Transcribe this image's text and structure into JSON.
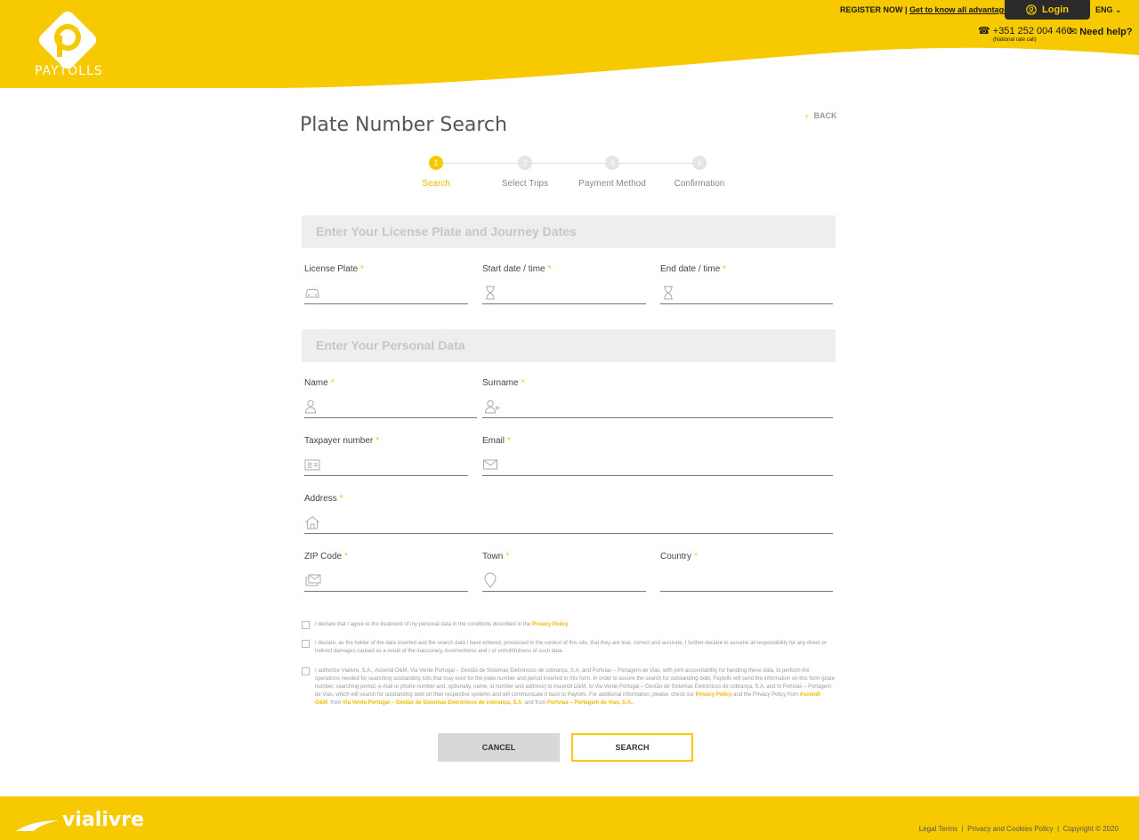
{
  "header": {
    "brand": "PAYTOLLS",
    "register": "REGISTER NOW",
    "advantages": "Get to know all advantages",
    "login": "Login",
    "language": "ENG",
    "phone": "+351 252 004 460",
    "phone_note": "(National rate call)",
    "help": "Need help?"
  },
  "page": {
    "title": "Plate Number Search",
    "back": "BACK"
  },
  "steps": [
    {
      "num": "1",
      "label": "Search",
      "active": true
    },
    {
      "num": "2",
      "label": "Select Trips"
    },
    {
      "num": "3",
      "label": "Payment Method"
    },
    {
      "num": "4",
      "label": "Confirmation"
    }
  ],
  "sections": {
    "journey": "Enter Your License Plate and Journey Dates",
    "personal": "Enter Your Personal Data"
  },
  "fields": {
    "license_plate": "License Plate",
    "start_date": "Start date / time",
    "end_date": "End date / time",
    "name": "Name",
    "surname": "Surname",
    "taxpayer": "Taxpayer number",
    "email": "Email",
    "address": "Address",
    "zip": "ZIP Code",
    "town": "Town",
    "country": "Country",
    "required": "*"
  },
  "consents": {
    "c1_text": "I declare that I agree to the treatment of my personal data in the conditions described in the",
    "c1_link": "Privacy Policy",
    "c2_text": "I declare, as the holder of the data inserted and the search data I have entered, processed in the context of this site, that they are true, correct and accurate. I further declare to assume all responsibility for any direct or indirect damages caused as a result of the inaccuracy, incorrectness and / or untruthfulness of such data.",
    "c3_text": "I authorize Vialivre, S.A., Ascendi O&M, Via Verde Portugal – Gestão de Sistemas Eletrónicos de cobrança, S.A. and Portvias – Portagem de Vias, with joint accountability for handling these data, to perform the operations needed for searching outstanding tolls that may exist for the plate number and period inserted in this form. In order to assure the search for outstanding debt, Paytolls will send the information on this form (plate number, searching period, e-mail or phone number and, optionally, name, id number and address) to Ascendi O&M, to Via Verde Portugal – Gestão de Sistemas Eletrónicos de cobrança, S.A. and to Portvias – Portagem de Vias, which will search for outstanding debt on their respective systems and will communicate it back to Paytolls. For additional information, please, check our",
    "c3_link1": "Privacy Policy",
    "c3_mid1": "and the Privacy Policy from",
    "c3_link2": "Ascendi O&M",
    "c3_mid2": ", from",
    "c3_link3": "Via Verde Portugal – Gestão de Sistemas Eletrónicos de cobrança, S.A.",
    "c3_mid3": "and from",
    "c3_link4": "Portvias – Portagem de Vias, S.A.",
    "c3_end": "."
  },
  "buttons": {
    "cancel": "CANCEL",
    "search": "SEARCH"
  },
  "footer": {
    "brand": "vialivre",
    "legal": "Legal Terms",
    "sep": "|",
    "privacy": "Privacy and Cookies Policy",
    "copyright": "Copyright © 2020"
  },
  "colors": {
    "brand_yellow": "#f7c900",
    "dark": "#2b2b2b"
  }
}
